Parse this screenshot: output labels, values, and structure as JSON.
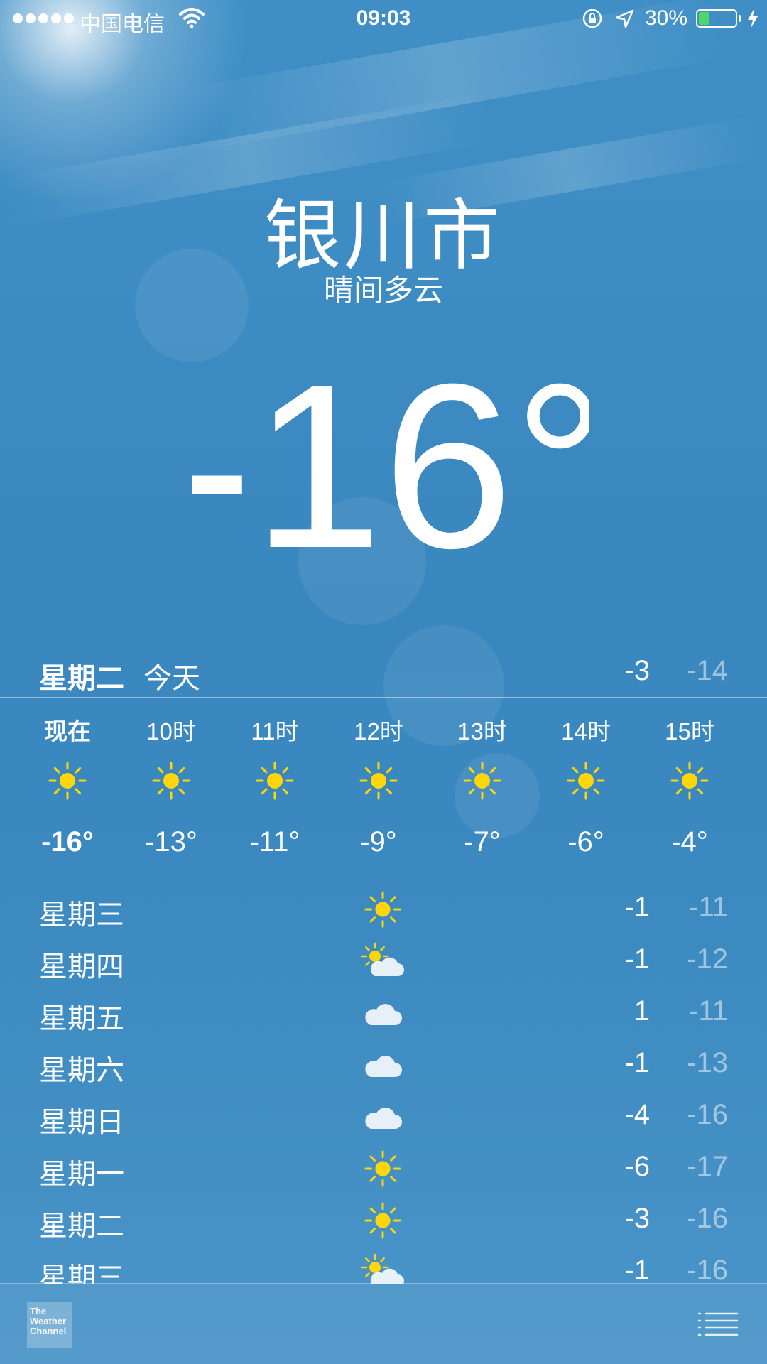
{
  "status_bar": {
    "carrier": "中国电信",
    "time": "09:03",
    "battery_percent": "30%",
    "battery_level": 0.3,
    "icons": [
      "signal-dots-icon",
      "wifi-icon",
      "rotation-lock-icon",
      "location-arrow-icon",
      "battery-icon",
      "charging-bolt-icon"
    ]
  },
  "location": {
    "city": "银川市",
    "condition": "晴间多云",
    "temperature": "-16°"
  },
  "today": {
    "day": "星期二",
    "label": "今天",
    "high": "-3",
    "low": "-14"
  },
  "hourly": [
    {
      "time": "现在",
      "icon": "sun-icon",
      "temp": "-16°"
    },
    {
      "time": "10时",
      "icon": "sun-icon",
      "temp": "-13°"
    },
    {
      "time": "11时",
      "icon": "sun-icon",
      "temp": "-11°"
    },
    {
      "time": "12时",
      "icon": "sun-icon",
      "temp": "-9°"
    },
    {
      "time": "13时",
      "icon": "sun-icon",
      "temp": "-7°"
    },
    {
      "time": "14时",
      "icon": "sun-icon",
      "temp": "-6°"
    },
    {
      "time": "15时",
      "icon": "sun-icon",
      "temp": "-4°"
    }
  ],
  "daily": [
    {
      "day": "星期三",
      "icon": "sun-icon",
      "high": "-1",
      "low": "-11"
    },
    {
      "day": "星期四",
      "icon": "partly-cloudy-icon",
      "high": "-1",
      "low": "-12"
    },
    {
      "day": "星期五",
      "icon": "cloud-icon",
      "high": "1",
      "low": "-11"
    },
    {
      "day": "星期六",
      "icon": "cloud-icon",
      "high": "-1",
      "low": "-13"
    },
    {
      "day": "星期日",
      "icon": "cloud-icon",
      "high": "-4",
      "low": "-16"
    },
    {
      "day": "星期一",
      "icon": "sun-icon",
      "high": "-6",
      "low": "-17"
    },
    {
      "day": "星期二",
      "icon": "sun-icon",
      "high": "-3",
      "low": "-16"
    },
    {
      "day": "星期三",
      "icon": "partly-cloudy-icon",
      "high": "-1",
      "low": "-16"
    }
  ],
  "bottom_bar": {
    "logo_text": "The Weather Channel",
    "logo_line1": "The",
    "logo_line2": "Weather",
    "logo_line3": "Channel",
    "list_icon": "list-icon"
  },
  "colors": {
    "sun": "#ffd60a",
    "battery_fill": "#4cd964",
    "low_temp": "rgba(255,255,255,0.5)"
  }
}
